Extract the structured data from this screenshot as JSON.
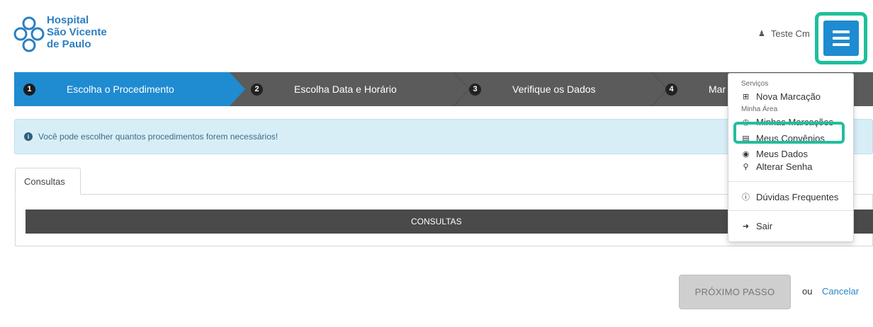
{
  "header": {
    "logo_lines": [
      "Hospital",
      "São Vicente",
      "de Paulo"
    ],
    "user_name": "Teste Cm"
  },
  "steps": [
    {
      "number": "1",
      "label": "Escolha o Procedimento"
    },
    {
      "number": "2",
      "label": "Escolha Data e Horário"
    },
    {
      "number": "3",
      "label": "Verifique os Dados"
    },
    {
      "number": "4",
      "label": "Mar"
    }
  ],
  "alert": {
    "icon": "info-icon",
    "text": "Você pode escolher quantos procedimentos forem necessários!"
  },
  "tabs": {
    "active": "Consultas"
  },
  "panel": {
    "heading": "CONSULTAS"
  },
  "footer": {
    "next_label": "PRÓXIMO PASSO",
    "or_text": "ou",
    "cancel_label": "Cancelar"
  },
  "menu": {
    "section_services": "Serviços",
    "new_booking": "Nova Marcação",
    "section_area": "Minha Área",
    "my_bookings": "Minhas Marcações",
    "my_insurance": "Meus Convênios",
    "my_data": "Meus Dados",
    "change_password": "Alterar Senha",
    "faq": "Dúvidas Frequentes",
    "logout": "Sair"
  },
  "colors": {
    "brand_blue": "#1f8bd1",
    "highlight_teal": "#1fbf9c",
    "steps_bar": "#5b5b5b",
    "alert_bg": "#d8eef7"
  }
}
